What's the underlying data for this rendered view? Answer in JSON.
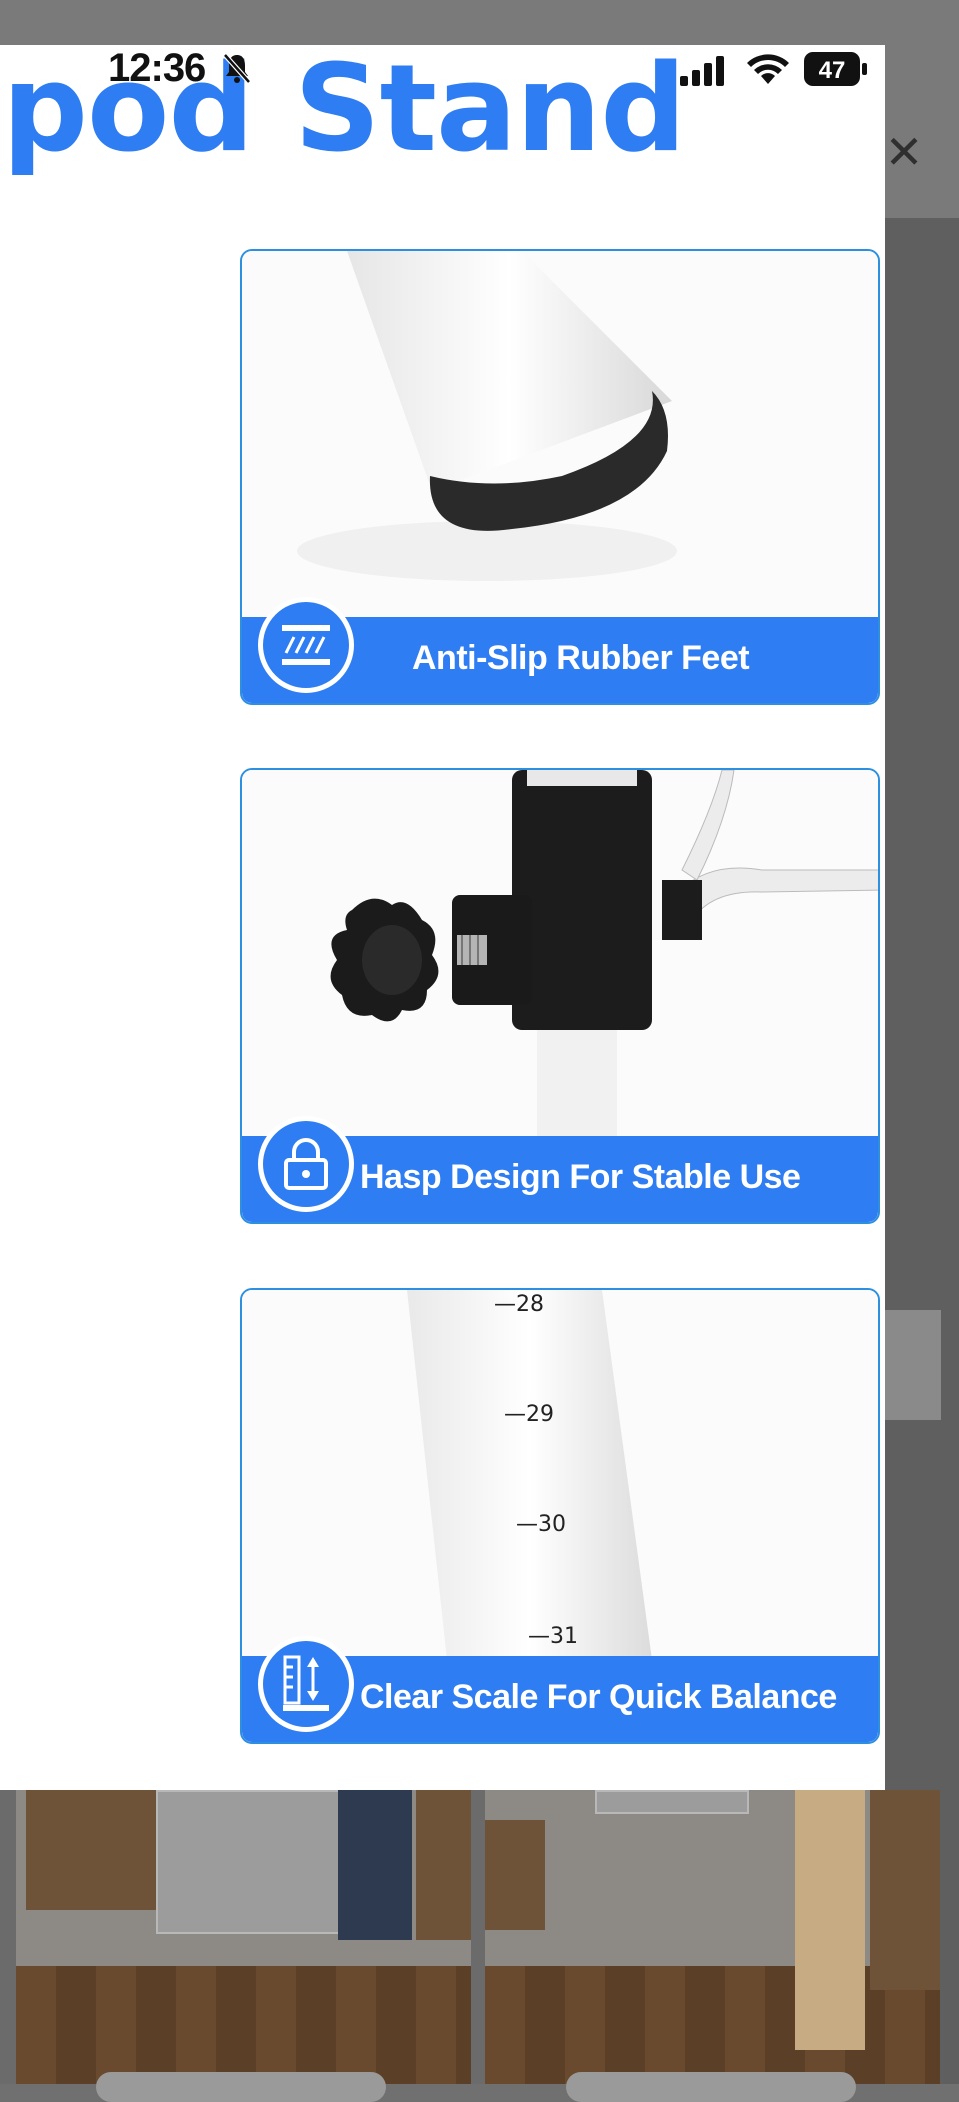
{
  "status_bar": {
    "time": "12:36",
    "battery": "47"
  },
  "close_glyph": "✕",
  "overlay": {
    "title": "ipod Stand",
    "features": [
      {
        "label": "Anti-Slip Rubber Feet",
        "icon": "rubber-texture-icon"
      },
      {
        "label": "Hasp Design For Stable Use",
        "icon": "padlock-icon"
      },
      {
        "label": "Clear Scale For Quick Balance",
        "icon": "height-ruler-icon"
      }
    ],
    "scale_marks": [
      "28",
      "29",
      "30",
      "31"
    ]
  },
  "colors": {
    "accent": "#2f7df2",
    "card_border": "#2d8fe0"
  }
}
